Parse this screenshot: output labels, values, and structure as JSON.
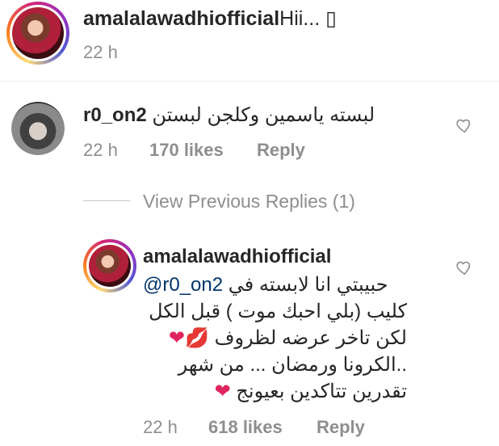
{
  "post": {
    "username": "amalalawadhiofficial",
    "caption": "Hii... ",
    "caption_glyph": "▯",
    "time": "22 h"
  },
  "comment": {
    "username": "r0_on2",
    "text": "لبسته ياسمين وكلجن لبستن",
    "time": "22 h",
    "likes": "170 likes",
    "reply": "Reply"
  },
  "view_previous": "View Previous Replies (1)",
  "reply": {
    "username": "amalalawadhiofficial",
    "mention": "@r0_on2",
    "line1_text": "حبيبتي انا لابسته في",
    "line2": "كليب (بلي احبك موت ) قبل الكل",
    "line3_text": "لكن تاخر عرضه لظروف",
    "line3_emoji": "❤💋",
    "line4": "..الكرونا ورمضان ... من شهر",
    "line5_text": "تقدرين تتاكدين بعيونج",
    "line5_emoji": "❤",
    "time": "22 h",
    "likes": "618 likes",
    "reply": "Reply"
  },
  "colors": {
    "heart": "#e0245e",
    "mention": "#00376b",
    "meta": "#8e8e8e"
  }
}
